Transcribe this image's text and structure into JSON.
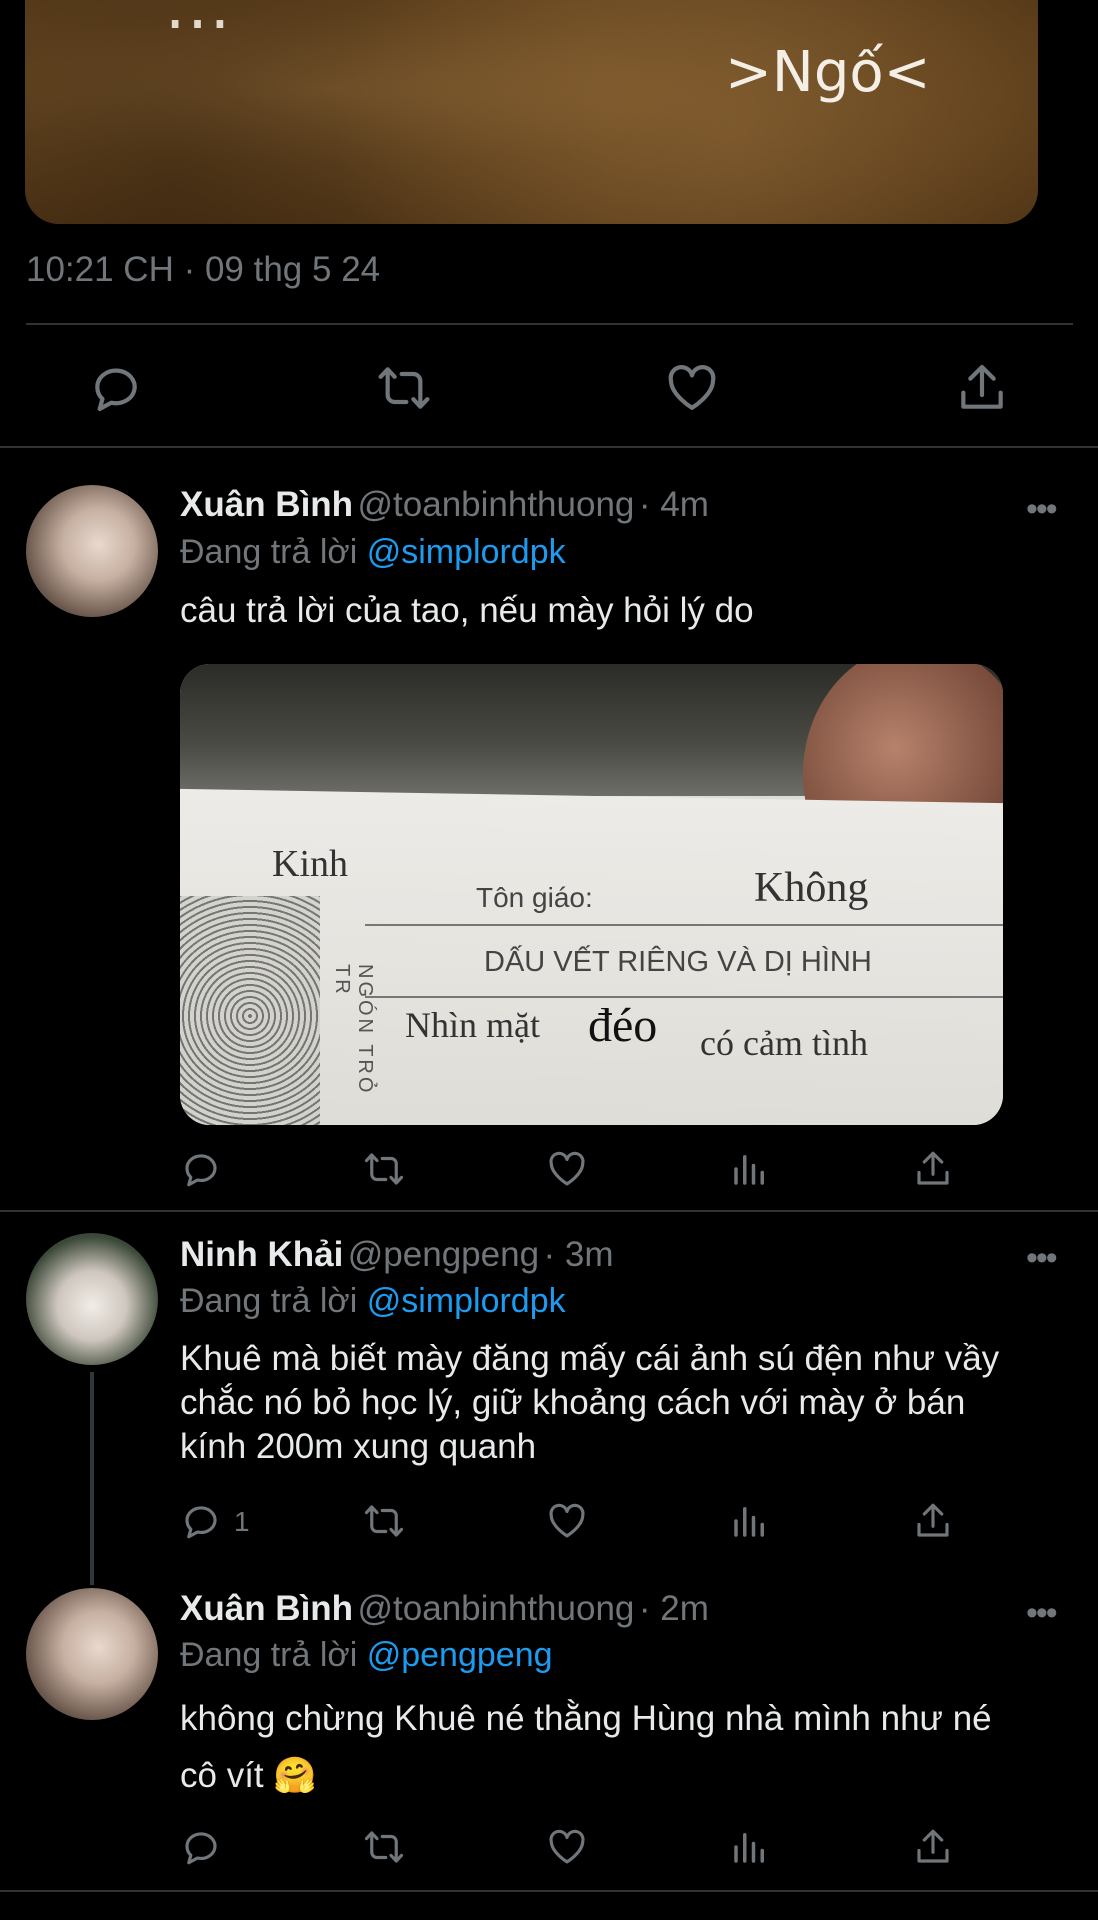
{
  "top_tweet": {
    "media_caption_top": "...",
    "media_caption": ">Ngố<",
    "timestamp": "10:21 CH · 09 thg 5 24"
  },
  "replies": [
    {
      "name": "Xuân Bình",
      "handle": "@toanbinhthuong",
      "time": "· 4m",
      "replying_label": "Đang trả lời",
      "replying_to": "@simplordpk",
      "text": "câu trả lời của tao, nếu mày hỏi lý do",
      "media": {
        "word_kinh": "Kinh",
        "ton_giao": "Tôn giáo:",
        "khong": "Không",
        "dau_vet": "DẤU VẾT RIÊNG VÀ DỊ HÌNH",
        "nhin_mat": "Nhìn mặt",
        "deo": "đéo",
        "co_cam_tinh": "có cảm tình",
        "ngon_tro": "NGÓN TRỎ TR"
      }
    },
    {
      "name": "Ninh Khải",
      "handle": "@pengpeng",
      "time": "· 3m",
      "replying_label": "Đang trả lời",
      "replying_to": "@simplordpk",
      "text_lines": [
        "Khuê mà biết mày đăng mấy cái ảnh sú đện như vầy",
        "chắc nó bỏ học lý, giữ khoảng cách với mày ở bán",
        "kính 200m xung quanh"
      ],
      "reply_count": "1"
    },
    {
      "name": "Xuân Bình",
      "handle": "@toanbinhthuong",
      "time": "· 2m",
      "replying_label": "Đang trả lời",
      "replying_to": "@pengpeng",
      "text_lines": [
        "không chừng Khuê né thằng Hùng nhà mình như né",
        "cô vít 🤗"
      ]
    }
  ],
  "more_label": "•••",
  "colors": {
    "bg": "#000000",
    "text": "#e7e9ea",
    "muted": "#71767b",
    "link": "#1d9bf0",
    "divider": "#2f3336"
  },
  "icons": [
    "reply-icon",
    "retweet-icon",
    "like-icon",
    "views-icon",
    "share-icon",
    "more-icon"
  ]
}
